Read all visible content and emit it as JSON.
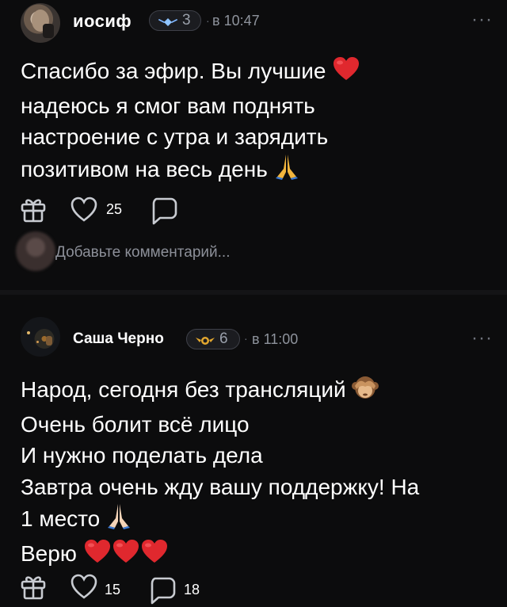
{
  "colors": {
    "background": "#0c0c0d",
    "text": "#ffffff",
    "muted": "#8e939c",
    "heart": "#e0282e",
    "icon": "#c8cbd1",
    "badge_border": "#3e4048"
  },
  "posts": [
    {
      "author": "иосиф",
      "badge_level": "3",
      "badge_icon": "diamond-badge-icon",
      "separator": "·",
      "time": "в 10:47",
      "more": "···",
      "lines": [
        "Спасибо за эфир. Вы лучшие",
        "надеюсь я смог вам поднять",
        "настроение с утра и зарядить",
        "позитивом на весь день"
      ],
      "emojis": [
        "red-heart",
        "folded-hands"
      ],
      "likes": "25",
      "comments": "",
      "add_comment_placeholder": "Добавьте комментарий..."
    },
    {
      "author": "Саша Черно",
      "badge_level": "6",
      "badge_icon": "winged-badge-icon",
      "separator": "·",
      "time": "в 11:00",
      "more": "···",
      "lines": [
        "Народ, сегодня без трансляций",
        "Очень болит всё лицо",
        "И нужно поделать дела",
        "Завтра очень жду вашу поддержку! На",
        "1 место",
        "Верю"
      ],
      "emojis": [
        "see-no-evil-monkey",
        "folded-hands",
        "red-heart",
        "red-heart",
        "red-heart"
      ],
      "likes": "15",
      "comments": "18"
    }
  ]
}
